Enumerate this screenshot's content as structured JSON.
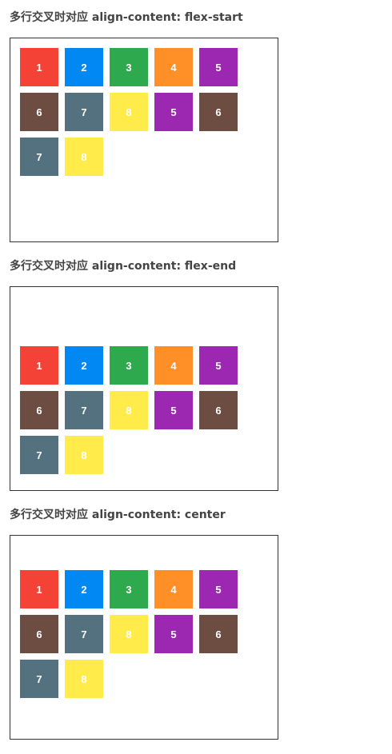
{
  "sections": [
    {
      "title": "多行交叉时对应 align-content: flex-start",
      "items": [
        {
          "label": "1",
          "color": "#f44336"
        },
        {
          "label": "2",
          "color": "#0288f2"
        },
        {
          "label": "3",
          "color": "#2fa94e"
        },
        {
          "label": "4",
          "color": "#ff8f26"
        },
        {
          "label": "5",
          "color": "#9c27b0"
        },
        {
          "label": "6",
          "color": "#6d4c41"
        },
        {
          "label": "7",
          "color": "#547180"
        },
        {
          "label": "8",
          "color": "#ffeb4a"
        },
        {
          "label": "5",
          "color": "#9c27b0"
        },
        {
          "label": "6",
          "color": "#6d4c41"
        },
        {
          "label": "7",
          "color": "#547180"
        },
        {
          "label": "8",
          "color": "#ffeb4a"
        }
      ]
    },
    {
      "title": "多行交叉时对应 align-content: flex-end",
      "items": [
        {
          "label": "1",
          "color": "#f44336"
        },
        {
          "label": "2",
          "color": "#0288f2"
        },
        {
          "label": "3",
          "color": "#2fa94e"
        },
        {
          "label": "4",
          "color": "#ff8f26"
        },
        {
          "label": "5",
          "color": "#9c27b0"
        },
        {
          "label": "6",
          "color": "#6d4c41"
        },
        {
          "label": "7",
          "color": "#547180"
        },
        {
          "label": "8",
          "color": "#ffeb4a"
        },
        {
          "label": "5",
          "color": "#9c27b0"
        },
        {
          "label": "6",
          "color": "#6d4c41"
        },
        {
          "label": "7",
          "color": "#547180"
        },
        {
          "label": "8",
          "color": "#ffeb4a"
        }
      ]
    },
    {
      "title": "多行交叉时对应 align-content: center",
      "items": [
        {
          "label": "1",
          "color": "#f44336"
        },
        {
          "label": "2",
          "color": "#0288f2"
        },
        {
          "label": "3",
          "color": "#2fa94e"
        },
        {
          "label": "4",
          "color": "#ff8f26"
        },
        {
          "label": "5",
          "color": "#9c27b0"
        },
        {
          "label": "6",
          "color": "#6d4c41"
        },
        {
          "label": "7",
          "color": "#547180"
        },
        {
          "label": "8",
          "color": "#ffeb4a"
        },
        {
          "label": "5",
          "color": "#9c27b0"
        },
        {
          "label": "6",
          "color": "#6d4c41"
        },
        {
          "label": "7",
          "color": "#547180"
        },
        {
          "label": "8",
          "color": "#ffeb4a"
        }
      ]
    }
  ]
}
